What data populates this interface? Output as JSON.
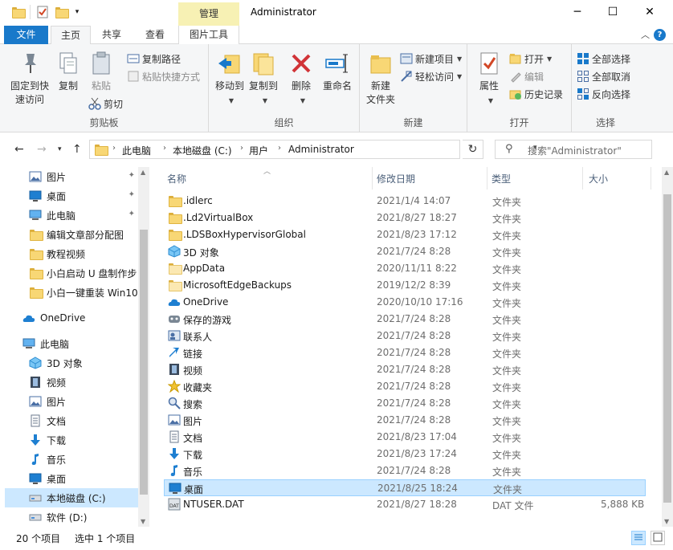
{
  "window": {
    "title": "Administrator",
    "context_tab": "管理"
  },
  "ribbon_tabs": {
    "file": "文件",
    "home": "主页",
    "share": "共享",
    "view": "查看",
    "picture_tools": "图片工具"
  },
  "ribbon": {
    "clipboard": {
      "label": "剪贴板",
      "pin": "固定到快\n速访问",
      "copy": "复制",
      "paste": "粘贴",
      "copy_path": "复制路径",
      "paste_shortcut": "粘贴快捷方式",
      "cut": "剪切"
    },
    "organize": {
      "label": "组织",
      "move_to": "移动到",
      "copy_to": "复制到",
      "delete": "删除",
      "rename": "重命名"
    },
    "new": {
      "label": "新建",
      "new_folder": "新建\n文件夹",
      "new_item": "新建项目",
      "easy_access": "轻松访问"
    },
    "open": {
      "label": "打开",
      "properties": "属性",
      "open": "打开",
      "edit": "编辑",
      "history": "历史记录"
    },
    "select": {
      "label": "选择",
      "select_all": "全部选择",
      "select_none": "全部取消",
      "invert": "反向选择"
    }
  },
  "address": {
    "crumbs": [
      "此电脑",
      "本地磁盘 (C:)",
      "用户",
      "Administrator"
    ],
    "search_placeholder": "搜索\"Administrator\""
  },
  "nav_items": [
    {
      "label": "图片",
      "icon": "pictures-icon",
      "pinned": true
    },
    {
      "label": "桌面",
      "icon": "desktop-icon",
      "pinned": true
    },
    {
      "label": "此电脑",
      "icon": "computer-icon",
      "pinned": true
    },
    {
      "label": "编辑文章部分配图",
      "icon": "folder-icon",
      "pinned": false
    },
    {
      "label": "教程视频",
      "icon": "folder-icon",
      "pinned": false
    },
    {
      "label": "小白启动 U 盘制作步",
      "icon": "folder-icon",
      "pinned": false
    },
    {
      "label": "小白一键重装 Win10",
      "icon": "folder-icon",
      "pinned": false
    },
    {
      "label": "OneDrive",
      "icon": "onedrive-icon",
      "pinned": false
    },
    {
      "label": "此电脑",
      "icon": "computer-icon",
      "pinned": false
    },
    {
      "label": "3D 对象",
      "icon": "3d-objects-icon",
      "pinned": false
    },
    {
      "label": "视频",
      "icon": "videos-icon",
      "pinned": false
    },
    {
      "label": "图片",
      "icon": "pictures-icon",
      "pinned": false
    },
    {
      "label": "文档",
      "icon": "documents-icon",
      "pinned": false
    },
    {
      "label": "下载",
      "icon": "downloads-icon",
      "pinned": false
    },
    {
      "label": "音乐",
      "icon": "music-icon",
      "pinned": false
    },
    {
      "label": "桌面",
      "icon": "desktop-icon",
      "pinned": false
    },
    {
      "label": "本地磁盘 (C:)",
      "icon": "drive-icon",
      "pinned": false
    },
    {
      "label": "软件 (D:)",
      "icon": "drive-icon",
      "pinned": false
    }
  ],
  "columns": {
    "name": "名称",
    "date": "修改日期",
    "type": "类型",
    "size": "大小"
  },
  "files": [
    {
      "name": ".idlerc",
      "date": "2021/1/4 14:07",
      "type": "文件夹",
      "size": "",
      "icon": "folder-icon"
    },
    {
      "name": ".Ld2VirtualBox",
      "date": "2021/8/27 18:27",
      "type": "文件夹",
      "size": "",
      "icon": "folder-icon"
    },
    {
      "name": ".LDSBoxHypervisorGlobal",
      "date": "2021/8/23 17:12",
      "type": "文件夹",
      "size": "",
      "icon": "folder-icon"
    },
    {
      "name": "3D 对象",
      "date": "2021/7/24 8:28",
      "type": "文件夹",
      "size": "",
      "icon": "3d-objects-icon"
    },
    {
      "name": "AppData",
      "date": "2020/11/11 8:22",
      "type": "文件夹",
      "size": "",
      "icon": "folder-pale-icon"
    },
    {
      "name": "MicrosoftEdgeBackups",
      "date": "2019/12/2 8:39",
      "type": "文件夹",
      "size": "",
      "icon": "folder-pale-icon"
    },
    {
      "name": "OneDrive",
      "date": "2020/10/10 17:16",
      "type": "文件夹",
      "size": "",
      "icon": "onedrive-icon"
    },
    {
      "name": "保存的游戏",
      "date": "2021/7/24 8:28",
      "type": "文件夹",
      "size": "",
      "icon": "saved-games-icon"
    },
    {
      "name": "联系人",
      "date": "2021/7/24 8:28",
      "type": "文件夹",
      "size": "",
      "icon": "contacts-icon"
    },
    {
      "name": "链接",
      "date": "2021/7/24 8:28",
      "type": "文件夹",
      "size": "",
      "icon": "links-icon"
    },
    {
      "name": "视频",
      "date": "2021/7/24 8:28",
      "type": "文件夹",
      "size": "",
      "icon": "videos-icon"
    },
    {
      "name": "收藏夹",
      "date": "2021/7/24 8:28",
      "type": "文件夹",
      "size": "",
      "icon": "favorites-icon"
    },
    {
      "name": "搜索",
      "date": "2021/7/24 8:28",
      "type": "文件夹",
      "size": "",
      "icon": "searches-icon"
    },
    {
      "name": "图片",
      "date": "2021/7/24 8:28",
      "type": "文件夹",
      "size": "",
      "icon": "pictures-icon"
    },
    {
      "name": "文档",
      "date": "2021/8/23 17:04",
      "type": "文件夹",
      "size": "",
      "icon": "documents-icon"
    },
    {
      "name": "下载",
      "date": "2021/8/23 17:24",
      "type": "文件夹",
      "size": "",
      "icon": "downloads-icon"
    },
    {
      "name": "音乐",
      "date": "2021/7/24 8:28",
      "type": "文件夹",
      "size": "",
      "icon": "music-icon"
    },
    {
      "name": "桌面",
      "date": "2021/8/25 18:24",
      "type": "文件夹",
      "size": "",
      "icon": "desktop-icon"
    },
    {
      "name": "NTUSER.DAT",
      "date": "2021/8/27 18:28",
      "type": "DAT 文件",
      "size": "5,888 KB",
      "icon": "dat-file-icon"
    }
  ],
  "selection": {
    "selected_nav_index": 16,
    "selected_file_index": 17
  },
  "status": {
    "count": "20 个项目",
    "selected": "选中 1 个项目"
  },
  "colors": {
    "accent": "#1979ca",
    "selection": "#cce8ff",
    "context_tab": "#f7f1b4",
    "folder": "#f8d775"
  }
}
